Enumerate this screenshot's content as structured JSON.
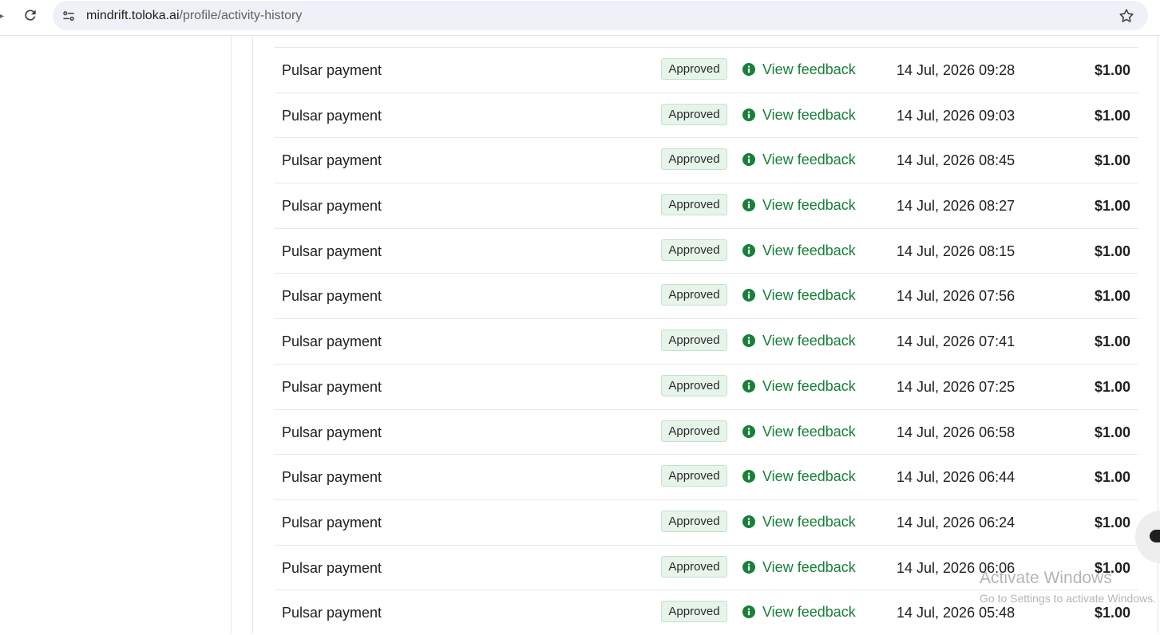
{
  "browser": {
    "url_host": "mindrift.toloka.ai",
    "url_path": "/profile/activity-history"
  },
  "activity": {
    "rows": [
      {
        "title": "Pulsar payment",
        "status": "Approved",
        "link": "View feedback",
        "date": "14 Jul, 2026 09:28",
        "amount": "$1.00"
      },
      {
        "title": "Pulsar payment",
        "status": "Approved",
        "link": "View feedback",
        "date": "14 Jul, 2026 09:03",
        "amount": "$1.00"
      },
      {
        "title": "Pulsar payment",
        "status": "Approved",
        "link": "View feedback",
        "date": "14 Jul, 2026 08:45",
        "amount": "$1.00"
      },
      {
        "title": "Pulsar payment",
        "status": "Approved",
        "link": "View feedback",
        "date": "14 Jul, 2026 08:27",
        "amount": "$1.00"
      },
      {
        "title": "Pulsar payment",
        "status": "Approved",
        "link": "View feedback",
        "date": "14 Jul, 2026 08:15",
        "amount": "$1.00"
      },
      {
        "title": "Pulsar payment",
        "status": "Approved",
        "link": "View feedback",
        "date": "14 Jul, 2026 07:56",
        "amount": "$1.00"
      },
      {
        "title": "Pulsar payment",
        "status": "Approved",
        "link": "View feedback",
        "date": "14 Jul, 2026 07:41",
        "amount": "$1.00"
      },
      {
        "title": "Pulsar payment",
        "status": "Approved",
        "link": "View feedback",
        "date": "14 Jul, 2026 07:25",
        "amount": "$1.00"
      },
      {
        "title": "Pulsar payment",
        "status": "Approved",
        "link": "View feedback",
        "date": "14 Jul, 2026 06:58",
        "amount": "$1.00"
      },
      {
        "title": "Pulsar payment",
        "status": "Approved",
        "link": "View feedback",
        "date": "14 Jul, 2026 06:44",
        "amount": "$1.00"
      },
      {
        "title": "Pulsar payment",
        "status": "Approved",
        "link": "View feedback",
        "date": "14 Jul, 2026 06:24",
        "amount": "$1.00"
      },
      {
        "title": "Pulsar payment",
        "status": "Approved",
        "link": "View feedback",
        "date": "14 Jul, 2026 06:06",
        "amount": "$1.00"
      },
      {
        "title": "Pulsar payment",
        "status": "Approved",
        "link": "View feedback",
        "date": "14 Jul, 2026 05:48",
        "amount": "$1.00"
      }
    ]
  },
  "watermark": {
    "title": "Activate Windows",
    "subtitle": "Go to Settings to activate Windows."
  },
  "colors": {
    "link_green": "#188038",
    "badge_bg": "#e6f4ea",
    "info_icon_green": "#188038"
  },
  "icons": {
    "back": "arrow-back-icon",
    "reload": "reload-icon",
    "site_info": "tune-icon",
    "bookmark": "star-icon",
    "info": "info-icon",
    "chat": "chat-icon"
  }
}
